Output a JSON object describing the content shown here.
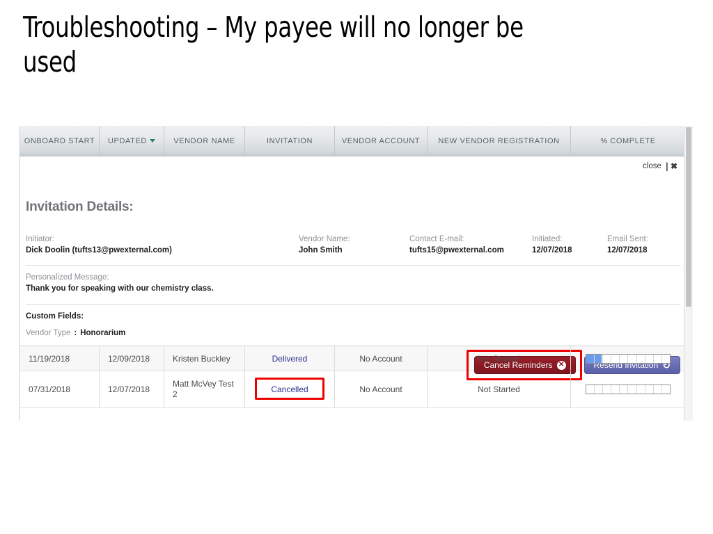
{
  "slide": {
    "title": "Troubleshooting – My payee will no longer be used"
  },
  "table": {
    "columns": [
      {
        "label": "ONBOARD START",
        "sortable": false
      },
      {
        "label": "UPDATED",
        "sortable": true,
        "sort_icon": "caret-down-icon"
      },
      {
        "label": "VENDOR NAME",
        "sortable": false
      },
      {
        "label": "INVITATION",
        "sortable": false
      },
      {
        "label": "VENDOR ACCOUNT",
        "sortable": false
      },
      {
        "label": "NEW VENDOR REGISTRATION",
        "sortable": false
      },
      {
        "label": "% COMPLETE",
        "sortable": false
      }
    ],
    "rows": [
      {
        "onboard_start": "11/19/2018",
        "updated": "12/09/2018",
        "vendor_name": "Kristen Buckley",
        "invitation": "Delivered",
        "vendor_account": "No Account",
        "new_vendor_registration": "Not Started",
        "percent_complete": 18,
        "highlighted": false
      },
      {
        "onboard_start": "07/31/2018",
        "updated": "12/07/2018",
        "vendor_name": "Matt McVey Test 2",
        "invitation": "Cancelled",
        "vendor_account": "No Account",
        "new_vendor_registration": "Not Started",
        "percent_complete": 0,
        "highlighted": true
      }
    ]
  },
  "details": {
    "title": "Invitation Details:",
    "close_label": "close",
    "close_icon": "close-icon",
    "fields": [
      {
        "label": "Initiator:",
        "value": "Dick Doolin (tufts13@pwexternal.com)"
      },
      {
        "label": "Vendor Name:",
        "value": "John Smith"
      },
      {
        "label": "Contact E-mail:",
        "value": "tufts15@pwexternal.com"
      },
      {
        "label": "Initiated:",
        "value": "12/07/2018"
      },
      {
        "label": "Email Sent:",
        "value": "12/07/2018"
      }
    ],
    "personalized_message": {
      "label": "Personalized Message:",
      "value": "Thank you for speaking with our chemistry class."
    },
    "custom_fields": {
      "title": "Custom Fields:",
      "items": [
        {
          "label": "Vendor Type",
          "separator": ":",
          "value": "Honorarium"
        }
      ]
    },
    "buttons": {
      "cancel_reminders": {
        "label": "Cancel Reminders",
        "icon": "cancel-circle-icon",
        "color": "#8d1a24"
      },
      "resend_invitation": {
        "label": "Resend Invitation",
        "icon": "refresh-icon",
        "color": "#6a6eb4"
      }
    }
  },
  "annotations": {
    "highlight_color": "#ee0000",
    "cancel_reminders_box": true,
    "cancelled_cell_box": true
  }
}
